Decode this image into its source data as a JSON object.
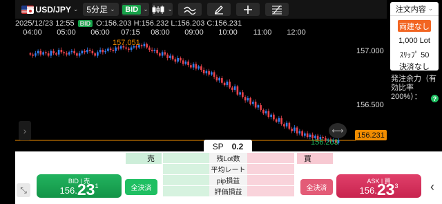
{
  "toolbar": {
    "pair": "USD/JPY",
    "timeframe": "5分足",
    "price_type": "BID"
  },
  "info": {
    "datetime": "2025/12/23 12:55",
    "tag": "BID",
    "ohlc": "O:156.203  H:156.232  L:156.203  C:156.231"
  },
  "time_axis": [
    "04:00",
    "05:00",
    "06:00",
    "07:15",
    "08:00",
    "09:00",
    "10:00",
    "11:00",
    "12:00"
  ],
  "price_axis": [
    "157.000",
    "156.500"
  ],
  "current_price": "156.231",
  "high_label": "157.051",
  "low_label": "156.203",
  "side_panel": {
    "title": "注文内容",
    "mode_button": "両建なし",
    "lot": "1,000 Lot",
    "slippage": "ｽﾘｯﾌﾟ 50",
    "settlement": "決済なし",
    "margin_label": "発注余力（有効比率200%）：",
    "help": "?"
  },
  "trade": {
    "sp_label": "SP",
    "sp_value": "0.2",
    "sell_label": "売",
    "buy_label": "買",
    "rows": [
      "残Lot数",
      "平均レート",
      "pip損益",
      "評価損益"
    ],
    "bid_title": "BID | 売",
    "bid_small": "156.",
    "bid_big": "23",
    "bid_sup": "1",
    "ask_title": "ASK | 買",
    "ask_small": "156.",
    "ask_big": "23",
    "ask_sup": "3",
    "settle_all": "全決済"
  },
  "chart_data": {
    "type": "candlestick",
    "ylim": [
      156.19,
      157.1
    ],
    "colors": {
      "up": "#2f7ff0",
      "down": "#e8434b",
      "current_line": "#f08c00"
    },
    "close": [
      156.96,
      156.95,
      156.97,
      156.99,
      156.96,
      156.98,
      156.97,
      156.95,
      156.99,
      156.97,
      156.96,
      157.0,
      156.98,
      156.97,
      156.96,
      156.98,
      156.99,
      156.97,
      156.95,
      156.97,
      156.99,
      156.98,
      157.0,
      156.99,
      156.97,
      156.95,
      156.98,
      157.0,
      156.98,
      156.99,
      157.01,
      157.0,
      156.99,
      157.02,
      157.01,
      157.03,
      157.02,
      157.01,
      157.0,
      157.02,
      157.03,
      157.02,
      157.04,
      157.03,
      157.05,
      157.02,
      157.0,
      156.99,
      157.0,
      156.97,
      156.95,
      156.98,
      156.96,
      156.93,
      156.95,
      156.92,
      156.9,
      156.93,
      156.91,
      156.88,
      156.9,
      156.87,
      156.85,
      156.88,
      156.84,
      156.86,
      156.83,
      156.8,
      156.82,
      156.79,
      156.81,
      156.77,
      156.74,
      156.76,
      156.72,
      156.7,
      156.73,
      156.68,
      156.66,
      156.69,
      156.62,
      156.64,
      156.6,
      156.57,
      156.59,
      156.54,
      156.56,
      156.51,
      156.53,
      156.49,
      156.46,
      156.48,
      156.43,
      156.45,
      156.41,
      156.39,
      156.42,
      156.37,
      156.35,
      156.38,
      156.33,
      156.31,
      156.34,
      156.29,
      156.31,
      156.27,
      156.29,
      156.26,
      156.28,
      156.25,
      156.27,
      156.24,
      156.26,
      156.25,
      156.23,
      156.24,
      156.22,
      156.23,
      156.21,
      156.231
    ]
  }
}
